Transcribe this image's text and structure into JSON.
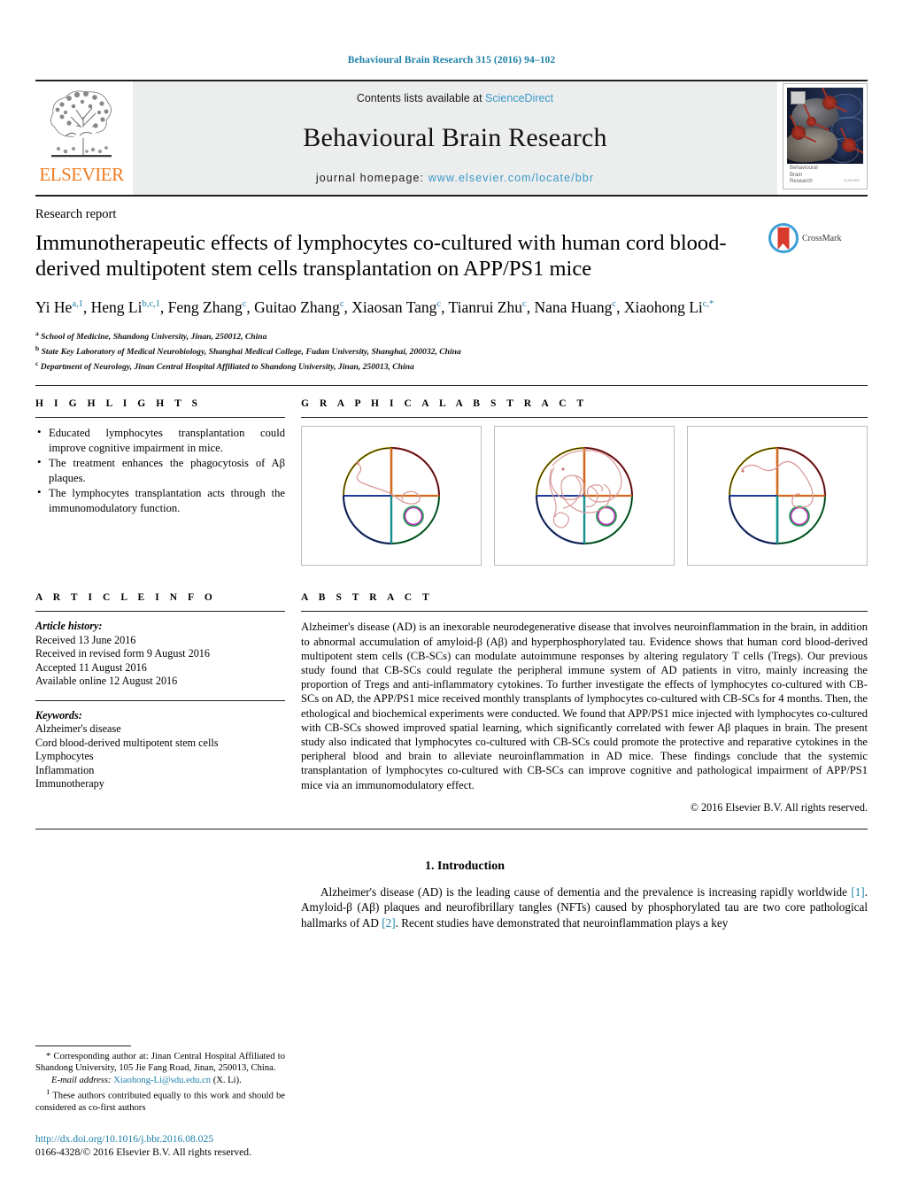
{
  "running_head": "Behavioural Brain Research 315 (2016) 94–102",
  "masthead": {
    "publisher": "ELSEVIER",
    "contents_prefix": "Contents lists available at ",
    "contents_link": "ScienceDirect",
    "journal_title": "Behavioural Brain Research",
    "homepage_prefix": "journal homepage: ",
    "homepage_url": "www.elsevier.com/locate/bbr",
    "cover_label_line1": "Behavioural",
    "cover_label_line2": "Brain",
    "cover_label_line3": "Research",
    "cover_label_tiny": "ELSEVIER"
  },
  "article": {
    "kind": "Research report",
    "title": "Immunotherapeutic effects of lymphocytes co-cultured with human cord blood-derived multipotent stem cells transplantation on APP/PS1 mice",
    "crossmark_label": "CrossMark",
    "authors": [
      {
        "name": "Yi He",
        "sup": "a,1",
        "sep": ", "
      },
      {
        "name": "Heng Li",
        "sup": "b,c,1",
        "sep": ", "
      },
      {
        "name": "Feng Zhang",
        "sup": "c",
        "sep": ", "
      },
      {
        "name": "Guitao Zhang",
        "sup": "c",
        "sep": ", "
      },
      {
        "name": "Xiaosan Tang",
        "sup": "c",
        "sep": ", "
      },
      {
        "name": "Tianrui Zhu",
        "sup": "c",
        "sep": ", "
      },
      {
        "name": "Nana Huang",
        "sup": "c",
        "sep": ", "
      },
      {
        "name": "Xiaohong Li",
        "sup": "c,*",
        "sep": ""
      }
    ],
    "affiliations": [
      {
        "mark": "a",
        "text": "School of Medicine, Shandong University, Jinan, 250012, China"
      },
      {
        "mark": "b",
        "text": "State Key Laboratory of Medical Neurobiology, Shanghai Medical College, Fudan University, Shanghai, 200032, China"
      },
      {
        "mark": "c",
        "text": "Department of Neurology, Jinan Central Hospital Affiliated to Shandong University, Jinan, 250013, China"
      }
    ]
  },
  "highlights": {
    "label": "H I G H L I G H T S",
    "items": [
      "Educated lymphocytes transplantation could improve cognitive impairment in mice.",
      "The treatment enhances the phagocytosis of Aβ plaques.",
      "The lymphocytes transplantation acts through the immunomodulatory function."
    ]
  },
  "graphical_abstract": {
    "label": "G R A P H I C A L   A B S T R A C T",
    "panels": [
      {
        "name": "panel-1-short-path",
        "description": "Morris water maze swim path with short direct track to platform"
      },
      {
        "name": "panel-2-long-path",
        "description": "Morris water maze swim path with long meandering track"
      },
      {
        "name": "panel-3-medium-path",
        "description": "Morris water maze swim path with moderate track"
      }
    ]
  },
  "article_info": {
    "label": "A R T I C L E   I N F O",
    "history_header": "Article history:",
    "history": [
      "Received 13 June 2016",
      "Received in revised form 9 August 2016",
      "Accepted 11 August 2016",
      "Available online 12 August 2016"
    ],
    "keywords_header": "Keywords:",
    "keywords": [
      "Alzheimer's disease",
      "Cord blood-derived multipotent stem cells",
      "Lymphocytes",
      "Inflammation",
      "Immunotherapy"
    ]
  },
  "abstract": {
    "label": "A B S T R A C T",
    "text": "Alzheimer's disease (AD) is an inexorable neurodegenerative disease that involves neuroinflammation in the brain, in addition to abnormal accumulation of amyloid-β (Aβ) and hyperphosphorylated tau. Evidence shows that human cord blood-derived multipotent stem cells (CB-SCs) can modulate autoimmune responses by altering regulatory T cells (Tregs). Our previous study found that CB-SCs could regulate the peripheral immune system of AD patients in vitro, mainly increasing the proportion of Tregs and anti-inflammatory cytokines. To further investigate the effects of lymphocytes co-cultured with CB-SCs on AD, the APP/PS1 mice received monthly transplants of lymphocytes co-cultured with CB-SCs for 4 months. Then, the ethological and biochemical experiments were conducted. We found that APP/PS1 mice injected with lymphocytes co-cultured with CB-SCs showed improved spatial learning, which significantly correlated with fewer Aβ plaques in brain. The present study also indicated that lymphocytes co-cultured with CB-SCs could promote the protective and reparative cytokines in the peripheral blood and brain to alleviate neuroinflammation in AD mice. These findings conclude that the systemic transplantation of lymphocytes co-cultured with CB-SCs can improve cognitive and pathological impairment of APP/PS1 mice via an immunomodulatory effect.",
    "copyright": "© 2016 Elsevier B.V. All rights reserved."
  },
  "introduction": {
    "heading": "1. Introduction",
    "paragraph_part1": "Alzheimer's disease (AD) is the leading cause of dementia and the prevalence is increasing rapidly worldwide ",
    "ref1": "[1]",
    "paragraph_part2": ". Amyloid-β (Aβ) plaques and neurofibrillary tangles (NFTs) caused by phosphorylated tau are two core pathological hallmarks of AD ",
    "ref2": "[2]",
    "paragraph_part3": ". Recent studies have demonstrated that neuroinflammation plays a key"
  },
  "footnotes": {
    "corresponding_mark": "*",
    "corresponding_text": "Corresponding author at: Jinan Central Hospital Affiliated to Shandong University, 105 Jie Fang Road, Jinan, 250013, China.",
    "email_label": "E-mail address:",
    "email": "Xiaohong-Li@sdu.edu.cn",
    "email_suffix": "(X. Li).",
    "equal_mark": "1",
    "equal_text": "These authors contributed equally to this work and should be considered as co-first authors"
  },
  "doi_block": {
    "doi_url": "http://dx.doi.org/10.1016/j.bbr.2016.08.025",
    "issn_line": "0166-4328/© 2016 Elsevier B.V. All rights reserved."
  },
  "colors": {
    "link_blue": "#1a7fa8",
    "sciencedirect_blue": "#3a9ac9",
    "elsevier_orange": "#ef7d22",
    "band_grey": "#eceded",
    "crossmark_blue": "#3d9fd4",
    "crossmark_red": "#d83a2b"
  }
}
